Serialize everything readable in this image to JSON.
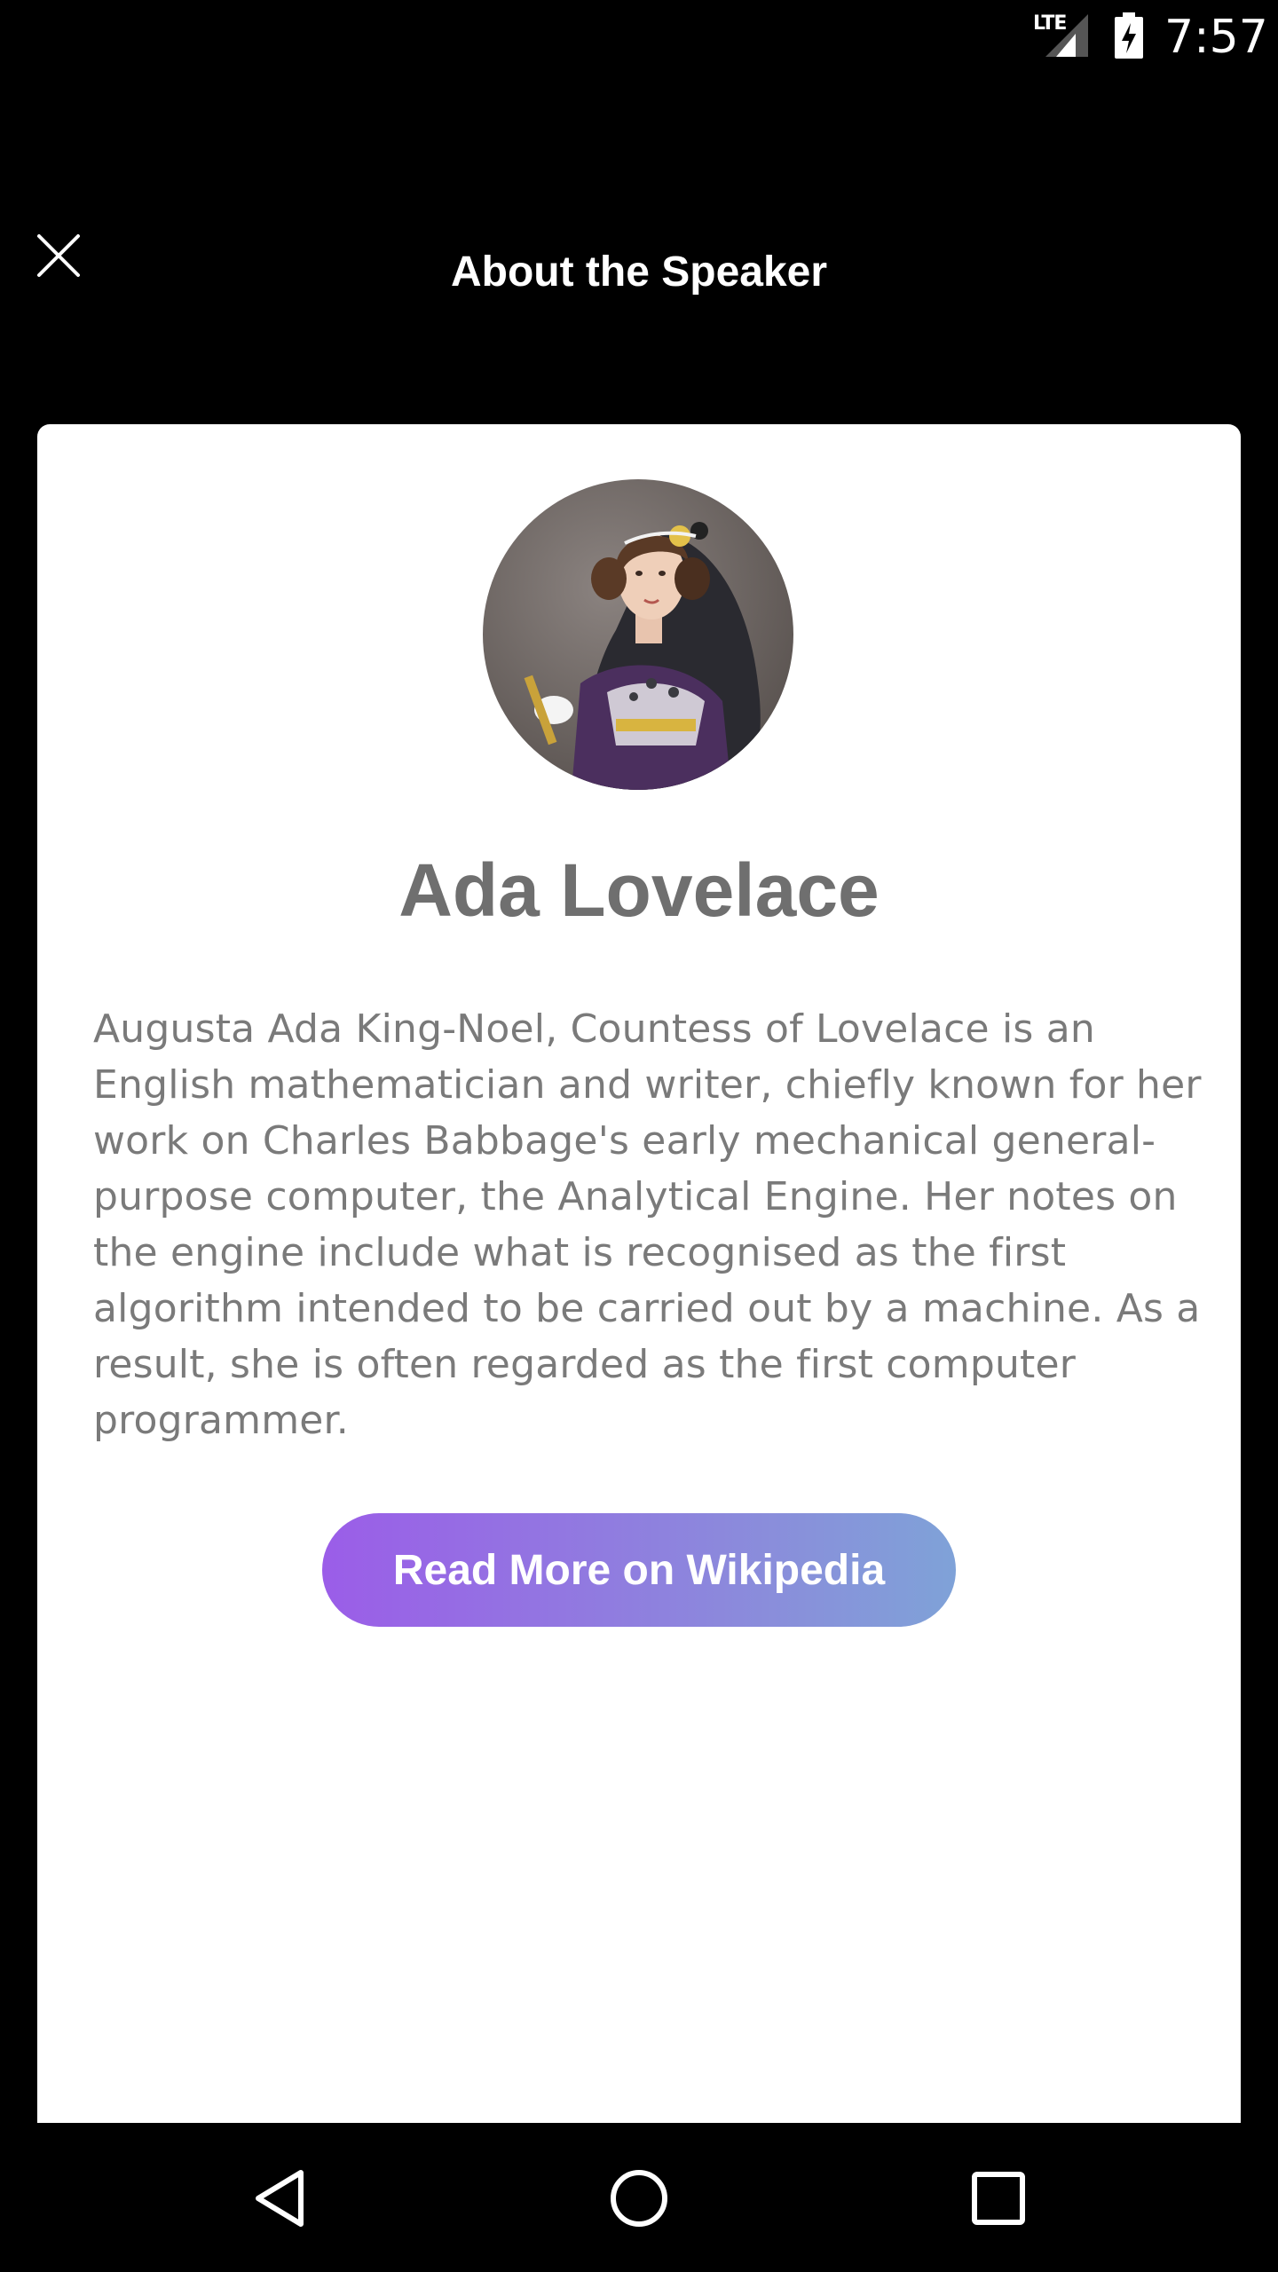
{
  "status_bar": {
    "network": "LTE",
    "time": "7:57",
    "icons": [
      "signal-icon",
      "battery-charging-icon"
    ]
  },
  "header": {
    "title": "About the Speaker",
    "close_icon": "close-icon"
  },
  "speaker": {
    "avatar_icon": "speaker-portrait",
    "name": "Ada Lovelace",
    "bio": "Augusta Ada King-Noel, Countess of Lovelace is an English mathematician and writer, chiefly known for her work on Charles Babbage's early mechanical general-purpose computer, the Analytical Engine. Her notes on the engine include what is recognised as the first algorithm intended to be carried out by a machine. As a result, she is often regarded as the first computer programmer.",
    "button_label": "Read More on Wikipedia"
  },
  "nav_bar": {
    "icons": [
      "back-icon",
      "home-icon",
      "recents-icon"
    ]
  },
  "colors": {
    "background": "#000000",
    "card": "#ffffff",
    "name_text": "#6f6f6f",
    "bio_text": "#7a7a7a",
    "button_gradient_start": "#9b5de8",
    "button_gradient_end": "#7fa2d8"
  }
}
